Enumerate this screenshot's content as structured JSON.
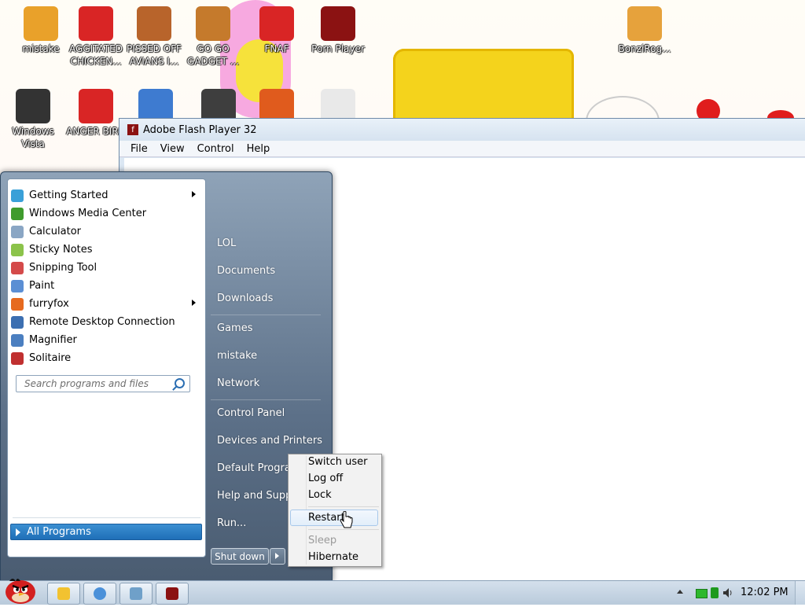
{
  "desktop": {
    "icons": [
      {
        "label": "mistake",
        "icon": "user-folder-icon",
        "color": "#e9a12a"
      },
      {
        "label": "AGGITATED CHICKEN...",
        "icon": "angry-bird-icon",
        "color": "#d92525"
      },
      {
        "label": "PISSED OFF AVIANS I...",
        "icon": "angry-birds-seasons-icon",
        "color": "#b8642b"
      },
      {
        "label": "GO GO GADGET ...",
        "icon": "briefcase-icon",
        "color": "#c57a2c"
      },
      {
        "label": "FNAF",
        "icon": "angry-bird-icon",
        "color": "#d92525"
      },
      {
        "label": "Porn Player",
        "icon": "flash-icon",
        "color": "#8b1212"
      },
      {
        "label": "BonziRog...",
        "icon": "folder-icon",
        "color": "#e6a23c"
      },
      {
        "label": "Windows Vista",
        "icon": "trash-can-icon",
        "color": "#333333"
      },
      {
        "label": "ANGER BIRD",
        "icon": "angry-bird-icon",
        "color": "#d92525"
      },
      {
        "label": "",
        "icon": "gear-monitor-icon",
        "color": "#3e7bd0"
      },
      {
        "label": "",
        "icon": "spider-solitaire-icon",
        "color": "#3e3e3e"
      },
      {
        "label": "",
        "icon": "pinball-icon",
        "color": "#e05b1d"
      },
      {
        "label": "",
        "icon": "cards-icon",
        "color": "#e9e9e9"
      }
    ]
  },
  "flash_window": {
    "title": "Adobe Flash Player 32",
    "menu": [
      "File",
      "View",
      "Control",
      "Help"
    ]
  },
  "start_menu": {
    "programs": [
      {
        "label": "Getting Started",
        "icon": "getting-started-icon",
        "submenu": true,
        "color": "#3aa0d8"
      },
      {
        "label": "Windows Media Center",
        "icon": "media-center-icon",
        "submenu": false,
        "color": "#3f9b2d"
      },
      {
        "label": "Calculator",
        "icon": "calculator-icon",
        "submenu": false,
        "color": "#8aa6c4"
      },
      {
        "label": "Sticky Notes",
        "icon": "sticky-notes-icon",
        "submenu": false,
        "color": "#8bc34a"
      },
      {
        "label": "Snipping Tool",
        "icon": "scissors-icon",
        "submenu": false,
        "color": "#d44a4a"
      },
      {
        "label": "Paint",
        "icon": "paint-icon",
        "submenu": false,
        "color": "#5b8fd4"
      },
      {
        "label": "furryfox",
        "icon": "firefox-icon",
        "submenu": true,
        "color": "#e66a1f"
      },
      {
        "label": "Remote Desktop Connection",
        "icon": "remote-desktop-icon",
        "submenu": false,
        "color": "#3c6fb1"
      },
      {
        "label": "Magnifier",
        "icon": "magnifier-icon",
        "submenu": false,
        "color": "#4b7fc0"
      },
      {
        "label": "Solitaire",
        "icon": "solitaire-icon",
        "submenu": false,
        "color": "#c03030"
      }
    ],
    "all_programs": "All Programs",
    "search_placeholder": "Search programs and files",
    "right_items": [
      "LOL",
      "Documents",
      "Downloads",
      "Games",
      "mistake",
      "Network",
      "Control Panel",
      "Devices and Printers",
      "Default Programs",
      "Help and Support",
      "Run..."
    ],
    "shutdown_label": "Shut down"
  },
  "power_menu": {
    "items": [
      {
        "label": "Switch user",
        "disabled": false
      },
      {
        "label": "Log off",
        "disabled": false
      },
      {
        "label": "Lock",
        "disabled": false
      },
      {
        "label": "Restart",
        "disabled": false,
        "highlighted": true
      },
      {
        "label": "Sleep",
        "disabled": true
      },
      {
        "label": "Hibernate",
        "disabled": false
      }
    ]
  },
  "taskbar": {
    "pinned": [
      {
        "name": "explorer-icon",
        "color": "#f2c230"
      },
      {
        "name": "chrome-icon",
        "color": "#4a90d9"
      },
      {
        "name": "image-viewer-icon",
        "color": "#6fa0c9"
      },
      {
        "name": "flash-icon",
        "color": "#8b1212"
      }
    ],
    "clock": "12:02 PM"
  }
}
